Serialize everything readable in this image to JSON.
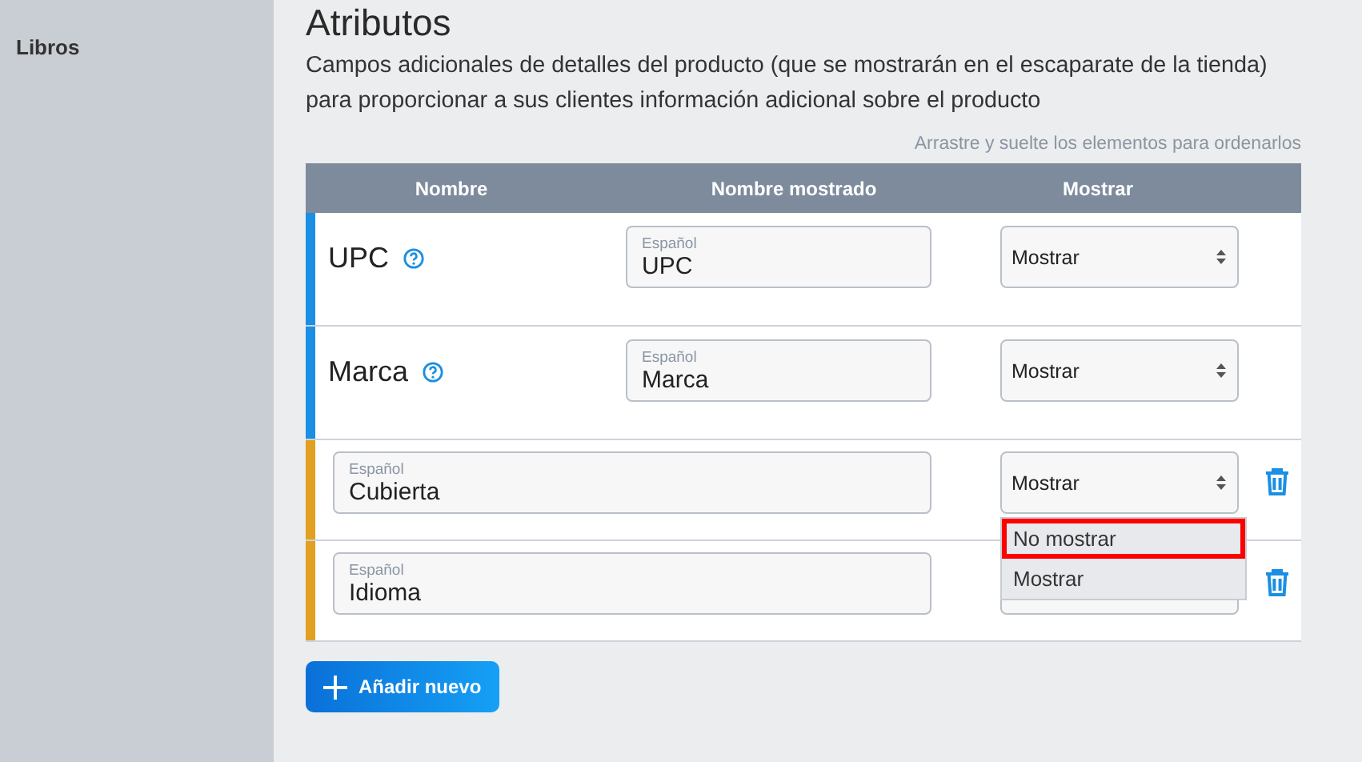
{
  "sidebar": {
    "items": [
      {
        "label": "Libros",
        "selected": true
      }
    ]
  },
  "title": "Atributos",
  "description": "Campos adicionales de detalles del producto (que se mostrarán en el escaparate de la tienda) para proporcionar a sus clientes información adicional sobre el producto",
  "hint": "Arrastre y suelte los elementos para ordenarlos",
  "table": {
    "columns": [
      "Nombre",
      "Nombre mostrado",
      "Mostrar"
    ],
    "rows": [
      {
        "kind": "builtin",
        "name": "UPC",
        "field_label": "Español",
        "field_value": "UPC",
        "select_value": "Mostrar"
      },
      {
        "kind": "builtin",
        "name": "Marca",
        "field_label": "Español",
        "field_value": "Marca",
        "select_value": "Mostrar"
      },
      {
        "kind": "custom",
        "field_label": "Español",
        "field_value": "Cubierta",
        "select_value": "Mostrar",
        "dropdown": {
          "options": [
            {
              "label": "No mostrar",
              "highlighted": true
            },
            {
              "label": "Mostrar",
              "highlighted": false
            }
          ]
        }
      },
      {
        "kind": "custom",
        "field_label": "Español",
        "field_value": "Idioma"
      }
    ]
  },
  "add_button": "Añadir nuevo"
}
